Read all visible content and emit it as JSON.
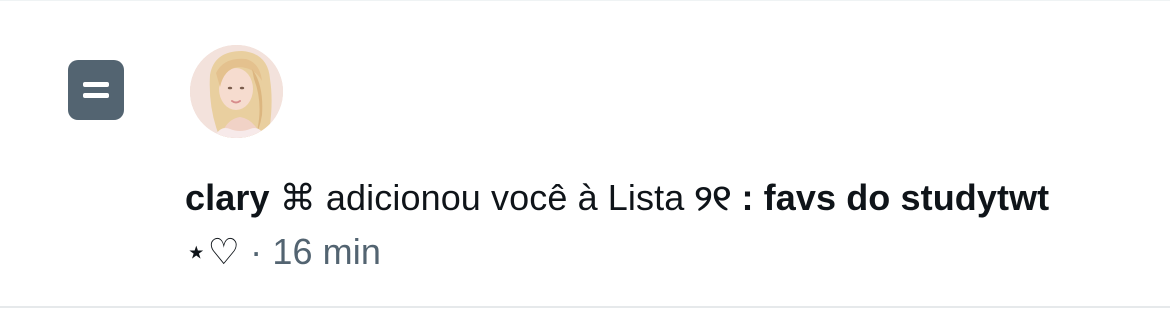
{
  "notification": {
    "type_icon": "list-icon",
    "avatar": "user-avatar",
    "user_name": "clary",
    "user_name_symbol": "⌘",
    "action_text": "adicionou você à Lista",
    "list_name": "୨୧ : favs do studytwt",
    "list_name_suffix": "⋆♡",
    "separator": "·",
    "timestamp": "16 min"
  },
  "colors": {
    "text_primary": "#0f1419",
    "text_secondary": "#536471",
    "icon_background": "#536471",
    "divider": "#eff3f4"
  }
}
